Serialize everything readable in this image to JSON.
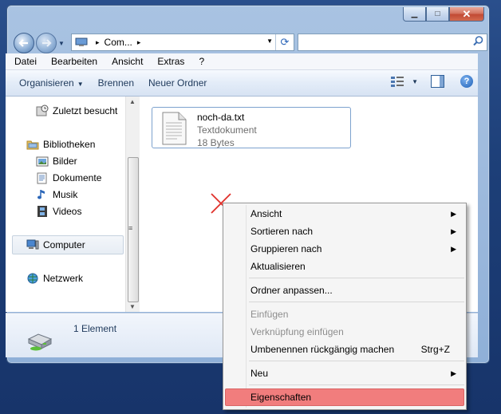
{
  "window": {
    "caption_buttons": [
      {
        "name": "minimize-button",
        "glyph": "▁"
      },
      {
        "name": "maximize-button",
        "glyph": "□"
      },
      {
        "name": "close-button",
        "glyph": "✕"
      }
    ]
  },
  "address": {
    "crumb": "Com...",
    "separator": "▸",
    "refresh_glyph": "⟳",
    "drop_glyph": "▼"
  },
  "search": {
    "placeholder": "",
    "icon": "search-icon"
  },
  "menubar": [
    "Datei",
    "Bearbeiten",
    "Ansicht",
    "Extras",
    "?"
  ],
  "toolbar": {
    "organize": "Organisieren",
    "burn": "Brennen",
    "new_folder": "Neuer Ordner",
    "help_glyph": "?"
  },
  "navpane": {
    "recent": "Zuletzt besucht",
    "libraries": "Bibliotheken",
    "pictures": "Bilder",
    "documents": "Dokumente",
    "music": "Musik",
    "videos": "Videos",
    "computer": "Computer",
    "network": "Netzwerk"
  },
  "file": {
    "name": "noch-da.txt",
    "type": "Textdokument",
    "size": "18 Bytes"
  },
  "status": {
    "count": "1 Element"
  },
  "context_menu": {
    "view": "Ansicht",
    "sort_by": "Sortieren nach",
    "group_by": "Gruppieren nach",
    "refresh": "Aktualisieren",
    "customize": "Ordner anpassen...",
    "paste": "Einfügen",
    "paste_shortcut": "Verknüpfung einfügen",
    "undo_rename": "Umbenennen rückgängig machen",
    "undo_shortcut": "Strg+Z",
    "new": "Neu",
    "properties": "Eigenschaften",
    "submenu_glyph": "▶"
  },
  "colors": {
    "desktop": "#1d3f78",
    "highlight": "#f17d7d",
    "x_mark": "#e0302a"
  }
}
